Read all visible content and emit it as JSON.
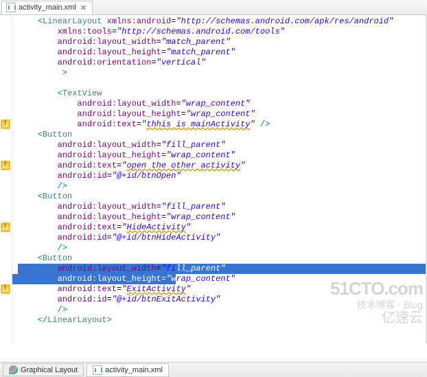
{
  "topTab": {
    "label": "activity_main.xml"
  },
  "warnings": [
    {
      "lineIndex": 10
    },
    {
      "lineIndex": 14
    },
    {
      "lineIndex": 20
    },
    {
      "lineIndex": 26
    }
  ],
  "code": {
    "lines": [
      {
        "indent": 1,
        "content": [
          {
            "t": "punct",
            "v": "<"
          },
          {
            "t": "tag",
            "v": "LinearLayout"
          },
          {
            "t": "plain",
            "v": " "
          },
          {
            "t": "attr",
            "v": "xmlns:android"
          },
          {
            "t": "plain",
            "v": "="
          },
          {
            "t": "val",
            "v": "\"http://schemas.android.com/apk/res/android\""
          }
        ]
      },
      {
        "indent": 2,
        "content": [
          {
            "t": "attr",
            "v": "xmlns:tools"
          },
          {
            "t": "plain",
            "v": "="
          },
          {
            "t": "val",
            "v": "\"http://schemas.android.com/tools\""
          }
        ]
      },
      {
        "indent": 2,
        "content": [
          {
            "t": "attr",
            "v": "android:layout_width"
          },
          {
            "t": "plain",
            "v": "="
          },
          {
            "t": "val",
            "v": "\"match_parent\""
          }
        ]
      },
      {
        "indent": 2,
        "content": [
          {
            "t": "attr",
            "v": "android:layout_height"
          },
          {
            "t": "plain",
            "v": "="
          },
          {
            "t": "val",
            "v": "\"match_parent\""
          }
        ]
      },
      {
        "indent": 2,
        "content": [
          {
            "t": "attr",
            "v": "android:orientation"
          },
          {
            "t": "plain",
            "v": "="
          },
          {
            "t": "val",
            "v": "\"vertical\""
          }
        ]
      },
      {
        "indent": 2,
        "content": [
          {
            "t": "punct",
            "v": " >"
          }
        ]
      },
      {
        "indent": 0,
        "content": []
      },
      {
        "indent": 2,
        "content": [
          {
            "t": "punct",
            "v": "<"
          },
          {
            "t": "tag",
            "v": "TextView"
          }
        ]
      },
      {
        "indent": 3,
        "content": [
          {
            "t": "attr",
            "v": "android:layout_width"
          },
          {
            "t": "plain",
            "v": "="
          },
          {
            "t": "val",
            "v": "\"wrap_content\""
          }
        ]
      },
      {
        "indent": 3,
        "content": [
          {
            "t": "attr",
            "v": "android:layout_height"
          },
          {
            "t": "plain",
            "v": "="
          },
          {
            "t": "val",
            "v": "\"wrap_content\""
          }
        ]
      },
      {
        "indent": 3,
        "content": [
          {
            "t": "attr",
            "v": "android:text"
          },
          {
            "t": "plain",
            "v": "="
          },
          {
            "t": "val",
            "v": "\"",
            "sq": false
          },
          {
            "t": "val",
            "v": "thhis is mainActivity",
            "sq": true
          },
          {
            "t": "val",
            "v": "\""
          },
          {
            "t": "plain",
            "v": " "
          },
          {
            "t": "punct",
            "v": "/>"
          }
        ]
      },
      {
        "indent": 1,
        "content": [
          {
            "t": "punct",
            "v": "<"
          },
          {
            "t": "tag",
            "v": "Button"
          }
        ]
      },
      {
        "indent": 2,
        "content": [
          {
            "t": "attr",
            "v": "android:layout_width"
          },
          {
            "t": "plain",
            "v": "="
          },
          {
            "t": "val",
            "v": "\"fill_parent\""
          }
        ]
      },
      {
        "indent": 2,
        "content": [
          {
            "t": "attr",
            "v": "android:layout_height"
          },
          {
            "t": "plain",
            "v": "="
          },
          {
            "t": "val",
            "v": "\"wrap_content\""
          }
        ]
      },
      {
        "indent": 2,
        "content": [
          {
            "t": "attr",
            "v": "android:text"
          },
          {
            "t": "plain",
            "v": "="
          },
          {
            "t": "val",
            "v": "\"",
            "sq": false
          },
          {
            "t": "val",
            "v": "open the other activity",
            "sq": true
          },
          {
            "t": "val",
            "v": "\""
          }
        ]
      },
      {
        "indent": 2,
        "content": [
          {
            "t": "attr",
            "v": "android:id"
          },
          {
            "t": "plain",
            "v": "="
          },
          {
            "t": "val",
            "v": "\"@+id/btnOpen\""
          }
        ]
      },
      {
        "indent": 2,
        "content": [
          {
            "t": "punct",
            "v": "/>"
          }
        ]
      },
      {
        "indent": 1,
        "content": [
          {
            "t": "punct",
            "v": "<"
          },
          {
            "t": "tag",
            "v": "Button"
          }
        ]
      },
      {
        "indent": 2,
        "content": [
          {
            "t": "attr",
            "v": "android:layout_width"
          },
          {
            "t": "plain",
            "v": "="
          },
          {
            "t": "val",
            "v": "\"fill_parent\""
          }
        ]
      },
      {
        "indent": 2,
        "content": [
          {
            "t": "attr",
            "v": "android:layout_height"
          },
          {
            "t": "plain",
            "v": "="
          },
          {
            "t": "val",
            "v": "\"wrap_content\""
          }
        ]
      },
      {
        "indent": 2,
        "content": [
          {
            "t": "attr",
            "v": "android:text"
          },
          {
            "t": "plain",
            "v": "="
          },
          {
            "t": "val",
            "v": "\"",
            "sq": false
          },
          {
            "t": "val",
            "v": "HideActivity",
            "sq": true
          },
          {
            "t": "val",
            "v": "\""
          }
        ]
      },
      {
        "indent": 2,
        "content": [
          {
            "t": "attr",
            "v": "android:id"
          },
          {
            "t": "plain",
            "v": "="
          },
          {
            "t": "val",
            "v": "\"@+id/btnHideActivity\""
          }
        ]
      },
      {
        "indent": 2,
        "content": [
          {
            "t": "punct",
            "v": "/>"
          }
        ]
      },
      {
        "indent": 1,
        "content": [
          {
            "t": "punct",
            "v": "<"
          },
          {
            "t": "tag",
            "v": "Button"
          }
        ]
      },
      {
        "indent": 2,
        "content": [
          {
            "t": "attr",
            "v": "android:layout_width"
          },
          {
            "t": "plain",
            "v": "="
          },
          {
            "t": "val",
            "v": "\"fi",
            "sq": false
          },
          {
            "t": "val",
            "v": "ll_parent\"",
            "sel": true
          }
        ],
        "selExtend": true
      },
      {
        "indent": 2,
        "content": [
          {
            "t": "attr",
            "v": "android:layout_height",
            "sel": true
          },
          {
            "t": "plain",
            "v": "=",
            "sel": true
          },
          {
            "t": "val",
            "v": "\"w",
            "sel": true
          },
          {
            "t": "val",
            "v": "rap_content\"",
            "sel": false
          }
        ],
        "selStart": true
      },
      {
        "indent": 2,
        "content": [
          {
            "t": "attr",
            "v": "android:text"
          },
          {
            "t": "plain",
            "v": "="
          },
          {
            "t": "val",
            "v": "\"",
            "sq": false
          },
          {
            "t": "val",
            "v": "ExitActivity",
            "sq": true
          },
          {
            "t": "val",
            "v": "\""
          }
        ]
      },
      {
        "indent": 2,
        "content": [
          {
            "t": "attr",
            "v": "android:id"
          },
          {
            "t": "plain",
            "v": "="
          },
          {
            "t": "val",
            "v": "\"@+id/btnExitActivity\""
          }
        ]
      },
      {
        "indent": 2,
        "content": [
          {
            "t": "punct",
            "v": "/>"
          }
        ]
      },
      {
        "indent": 1,
        "content": [
          {
            "t": "punct",
            "v": "</"
          },
          {
            "t": "tag",
            "v": "LinearLayout"
          },
          {
            "t": "punct",
            "v": ">"
          }
        ]
      }
    ]
  },
  "bottomTabs": [
    {
      "label": "Graphical Layout",
      "active": false
    },
    {
      "label": "activity_main.xml",
      "active": true
    }
  ],
  "watermark": {
    "line1": "51CTO.com",
    "line2": "技术博客 · Blog",
    "line3": "亿速云"
  }
}
